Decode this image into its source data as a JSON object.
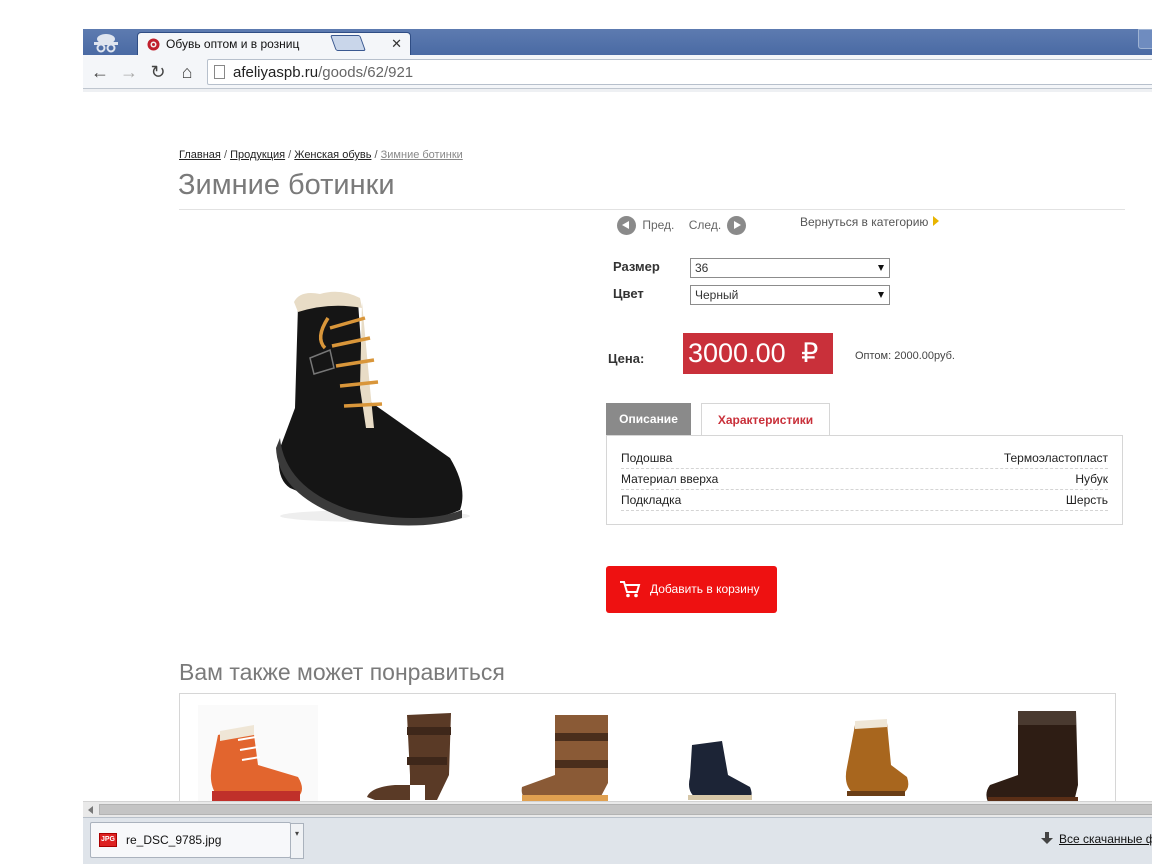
{
  "browser": {
    "tab_title": "Обувь оптом и в розниц",
    "url_host": "afeliyaspb.ru",
    "url_path": "/goods/62/921"
  },
  "breadcrumb": {
    "home": "Главная",
    "products": "Продукция",
    "women": "Женская обувь",
    "current": "Зимние ботинки",
    "separator": "/"
  },
  "product": {
    "title": "Зимние ботинки",
    "prev": "Пред.",
    "next": "След.",
    "back_to_category": "Вернуться в категорию",
    "size_label": "Размер",
    "size_value": "36",
    "color_label": "Цвет",
    "color_value": "Черный",
    "price_label": "Цена:",
    "price": "3000.00",
    "currency_symbol": "₽",
    "wholesale": "Оптом: 2000.00руб.",
    "tabs": [
      "Описание",
      "Характеристики"
    ],
    "specs": [
      {
        "name": "Подошва",
        "value": "Термоэластопласт"
      },
      {
        "name": "Материал вверха",
        "value": "Нубук"
      },
      {
        "name": "Подкладка",
        "value": "Шерсть"
      }
    ],
    "add_to_cart": "Добавить в корзину"
  },
  "related": {
    "title": "Вам также может понравиться"
  },
  "downloads": {
    "file_name": "re_DSC_9785.jpg",
    "file_type": "JPG",
    "all_downloads": "Все скачанные ф"
  },
  "colors": {
    "price_bg": "#c9303a",
    "cart_bg": "#ee1111",
    "active_tab_text": "#c9303a",
    "tab_inactive_bg": "#8a8a8a"
  }
}
